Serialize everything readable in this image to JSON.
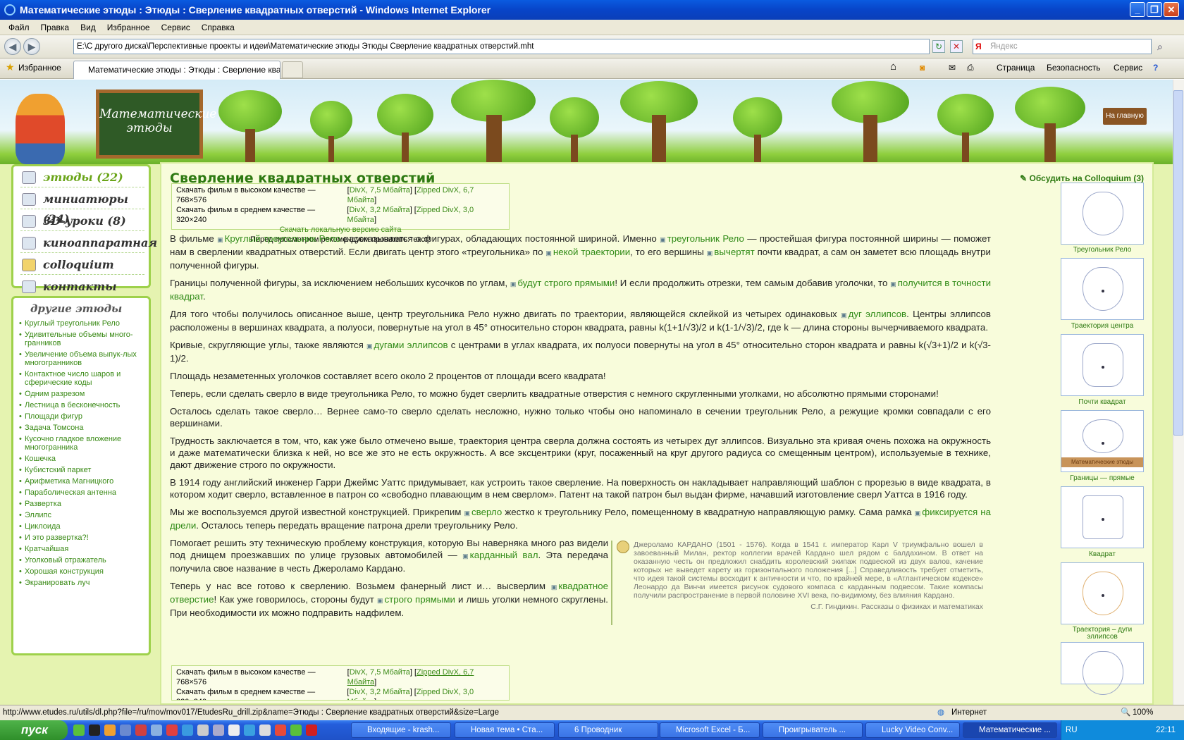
{
  "window": {
    "title": "Математические этюды : Этюды : Сверление квадратных отверстий - Windows Internet Explorer"
  },
  "menu": [
    "Файл",
    "Правка",
    "Вид",
    "Избранное",
    "Сервис",
    "Справка"
  ],
  "address": {
    "url": "E:\\С другого диска\\Перспективные проекты и идеи\\Математические этюды  Этюды  Сверление квадратных отверстий.mht",
    "search_placeholder": "Яндекс"
  },
  "tabbar": {
    "favorites": "Избранное",
    "tab_title": "Математические этюды : Этюды : Сверление ква...",
    "page_menu": "Страница",
    "safety_menu": "Безопасность",
    "tools_menu": "Сервис"
  },
  "header": {
    "board_text_1": "Математические",
    "board_text_2": "этюды",
    "home_sign": "На главную"
  },
  "left_menu": [
    {
      "label": "этюды (22)"
    },
    {
      "label": "миниатюры (24)"
    },
    {
      "label": "3D-уроки (8)"
    },
    {
      "label": "киноаппаратная"
    },
    {
      "label": "colloquium"
    },
    {
      "label": "контакты"
    }
  ],
  "other_etudes": {
    "heading": "другие этюды",
    "items": [
      "Круглый треугольник Рело",
      "Удивительные объемы много-гранников",
      "Увеличение объема выпук-лых многогранников",
      "Контактное число шаров и сферические коды",
      "Одним разрезом",
      "Лестница в бесконечность",
      "Площади фигур",
      "Задача Томсона",
      "Кусочно гладкое вложение многогранника",
      "Кошечка",
      "Кубистский паркет",
      "Арифметика Магницкого",
      "Параболическая антенна",
      "Развертка",
      "Эллипс",
      "Циклоида",
      "И это развертка?!",
      "Кратчайшая",
      "Уголковый отражатель",
      "Хорошая конструкция",
      "Экранировать луч"
    ]
  },
  "main": {
    "title": "Сверление квадратных отверстий",
    "discuss": "Обсудить на Colloquium (3)",
    "download": {
      "hq_label": "Скачать фильм в высоком качестве",
      "hq_res": "— 768×576",
      "hq_divx": "DivX, 7,5 Мбайта",
      "hq_zip": "Zipped DivX, 6,7 Мбайта",
      "mq_label": "Скачать фильм в среднем качестве",
      "mq_res": "— 320×240",
      "mq_divx": "DivX, 3,2 Мбайта",
      "mq_zip": "Zipped DivX, 3,0 Мбайта",
      "local": "Скачать локальную версию сайта",
      "note": "Перед просмотром рекомендуем прочитать текст!"
    },
    "p1a": "В фильме ",
    "p1_l1": "Круглый треугольник Рело",
    "p1b": " рассказывается о фигурах, обладающих постоянной шириной. Именно ",
    "p1_l2": "треугольник Рело",
    "p1c": " — простейшая фигура постоянной ширины — поможет нам в сверлении квадратных отверстий. Если двигать центр этого «треугольника» по ",
    "p1_l3": "некой траектории",
    "p1d": ", то его вершины ",
    "p1_l4": "вычертят",
    "p1e": " почти квадрат, а сам он заметет всю площадь внутри полученной фигуры.",
    "p2a": "Границы полученной фигуры, за исключением небольших кусочков по углам, ",
    "p2_l1": "будут строго прямыми",
    "p2b": "! И если продолжить отрезки, тем самым добавив уголочки, то ",
    "p2_l2": "получится в точности квадрат",
    "p2c": ".",
    "p3a": "Для того чтобы получилось описанное выше, центр треугольника Рело нужно двигать по траектории, являющейся склейкой из четырех одинаковых ",
    "p3_l1": "дуг эллипсов",
    "p3b": ". Центры эллипсов расположены в вершинах квадрата, а полуоси, повернутые на угол в 45° относительно сторон квадрата, равны k(1+1/√3)/2 и k(1-1/√3)/2, где k — длина стороны вычерчиваемого квадрата.",
    "p4a": "Кривые, скругляющие углы, также являются ",
    "p4_l1": "дугами эллипсов",
    "p4b": " с центрами в углах квадрата, их полуоси повернуты на угол в 45° относительно сторон квадрата и  равны k(√3+1)/2 и k(√3-1)/2.",
    "p5": "Площадь незаметенных уголочков составляет всего около 2 процентов от площади всего квадрата!",
    "p6": "Теперь, если сделать сверло в виде треугольника Рело, то можно будет сверлить квадратные отверстия с немного скругленными уголками, но абсолютно прямыми сторонами!",
    "p7": "Осталось сделать такое сверло… Вернее само-то сверло сделать несложно, нужно только чтобы оно напоминало в сечении треугольник Рело, а режущие кромки совпадали с его вершинами.",
    "p8": "Трудность заключается в том, что, как уже было отмечено выше, траектория центра сверла должна состоять из четырех дуг эллипсов. Визуально эта кривая очень похожа на окружность и даже математически близка к ней, но все же это не есть окружность. А все эксцентрики (круг, посаженный на круг другого радиуса со смещенным центром), используемые в технике, дают движение строго по окружности.",
    "p9": "В 1914 году английский инженер Гарри Джеймс Уаттс придумывает, как устроить такое сверление. На поверхность он накладывает направляющий шаблон с прорезью в виде квадрата, в котором ходит сверло, вставленное в патрон со «свободно плавающим в нем сверлом». Патент на такой патрон был выдан фирме, начавший изготовление сверл Уаттса в 1916 году.",
    "p10a": "Мы же воспользуемся другой известной конструкцией. Прикрепим ",
    "p10_l1": "сверло",
    "p10b": " жестко к треугольнику Рело, помещенному  в квадратную направляющую рамку. Сама рамка ",
    "p10_l2": "фиксируется на дрели",
    "p10c": ". Осталось теперь передать вращение патрона дрели треугольнику Рело.",
    "p11a": "Помогает решить эту техническую проблему конструкция, которую Вы наверняка много раз видели под днищем проезжавших по улице грузовых автомобилей — ",
    "p11_l1": "карданный вал",
    "p11b": ". Эта передача получила свое название в честь Джероламо Кардано.",
    "p12a": "Теперь у нас все готово к сверлению. Возьмем фанерный лист и… высверлим ",
    "p12_l1": "квадратное отверстие",
    "p12b": "! Как уже говорилось, стороны будут ",
    "p12_l2": "строго прямыми",
    "p12c": " и лишь уголки немного скруглены. При необходимости их можно подправить надфилем.",
    "quote": "Джероламо КАРДАНО (1501 - 1576). Когда в 1541 г. император Карл V триумфально вошел в завоеванный Милан, ректор коллегии врачей Кардано шел рядом с балдахином. В ответ на оказанную честь он предложил снабдить королевский экипаж подвеской из двух валов, качение которых не выведет карету из горизонтального положения [...] Справедливость требует отметить, что идея такой системы восходит к античности и что, по крайней мере, в «Атлантическом кодексе» Леонардо да Винчи имеется рисунок судового компаса с карданным подвесом. Такие компасы получили распространение в первой половине XVI века, по-видимому, без влияния Кардано.",
    "quote_src": "С.Г. Гиндикин. Рассказы о физиках и математиках"
  },
  "thumbnails": [
    "Треугольник Рело",
    "Траектория центра",
    "Почти квадрат",
    "Границы — прямые",
    "Квадрат",
    "Траектория – дуги эллипсов"
  ],
  "thumb_inner_text": "Математические этюды",
  "statusbar": {
    "url": "http://www.etudes.ru/utils/dl.php?file=/ru/mov/mov017/EtudesRu_drill.zip&name=Этюды : Сверление квадратных отверстий&size=Large",
    "zone": "Интернет",
    "zoom": "100%"
  },
  "taskbar": {
    "start": "пуск",
    "tasks": [
      "Входящие - krash...",
      "Новая тема • Ста...",
      "6 Проводник",
      "Microsoft Excel - Б...",
      "Проигрыватель ...",
      "Lucky Video Conv...",
      "Математические ..."
    ],
    "lang": "RU",
    "clock": "22:11"
  }
}
